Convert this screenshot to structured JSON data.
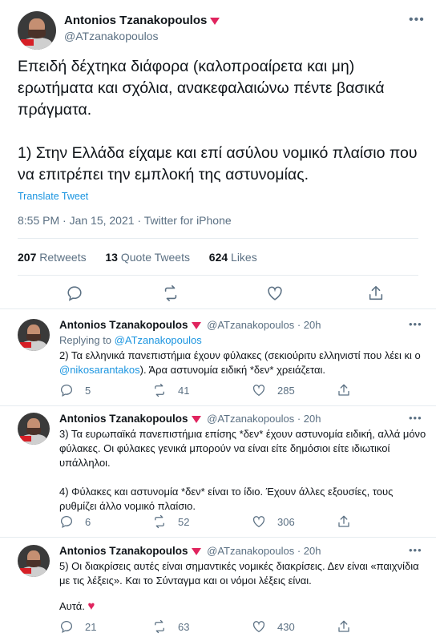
{
  "main_tweet": {
    "author_name": "Antonios Tzanakopoulos",
    "author_handle": "@ATzanakopoulos",
    "text_p1": "Επειδή δέχτηκα διάφορα (καλοπροαίρετα και μη) ερωτήματα και σχόλια, ανακεφαλαιώνω πέντε βασικά πράγματα.",
    "text_p2": "1) Στην Ελλάδα είχαμε και επί ασύλου νομικό πλαίσιο που να επιτρέπει την εμπλοκή της αστυνομίας.",
    "translate_label": "Translate Tweet",
    "timestamp": "8:55 PM · Jan 15, 2021 · Twitter for iPhone",
    "retweets_count": "207",
    "retweets_label": "Retweets",
    "quotes_count": "13",
    "quotes_label": "Quote Tweets",
    "likes_count": "624",
    "likes_label": "Likes"
  },
  "replies": [
    {
      "author_name": "Antonios Tzanakopoulos",
      "author_handle": "@ATzanakopoulos",
      "time": "20h",
      "replying_prefix": "Replying to",
      "replying_handle": "@ATzanakopoulos",
      "text_a": "2) Τα ελληνικά πανεπιστήμια έχουν φύλακες (σεκιούριτυ ελληνιστί που λέει κι ο ",
      "text_link": "@nikosarantakos",
      "text_b": "). Άρα αστυνομία ειδική *δεν* χρειάζεται.",
      "replies_count": "5",
      "retweets_count": "41",
      "likes_count": "285"
    },
    {
      "author_name": "Antonios Tzanakopoulos",
      "author_handle": "@ATzanakopoulos",
      "time": "20h",
      "text_p1": "3) Τα ευρωπαϊκά πανεπιστήμια επίσης *δεν* έχουν αστυνομία ειδική, αλλά μόνο φύλακες. Οι φύλακες γενικά μπορούν να είναι είτε δημόσιοι είτε ιδιωτικοί υπάλληλοι.",
      "text_p2": "4) Φύλακες και αστυνομία *δεν* είναι το ίδιο. Έχουν άλλες εξουσίες, τους ρυθμίζει άλλο νομικό πλαίσιο.",
      "replies_count": "6",
      "retweets_count": "52",
      "likes_count": "306"
    },
    {
      "author_name": "Antonios Tzanakopoulos",
      "author_handle": "@ATzanakopoulos",
      "time": "20h",
      "text_p1": "5) Οι διακρίσεις αυτές είναι σημαντικές νομικές διακρίσεις. Δεν είναι «παιχνίδια με τις λέξεις». Και το Σύνταγμα και οι νόμοι λέξεις είναι.",
      "text_p2": "Αυτά.",
      "replies_count": "21",
      "retweets_count": "63",
      "likes_count": "430"
    }
  ],
  "ui": {
    "more_glyph": "•••",
    "dot_sep": "·",
    "heart_glyph": "♥"
  }
}
